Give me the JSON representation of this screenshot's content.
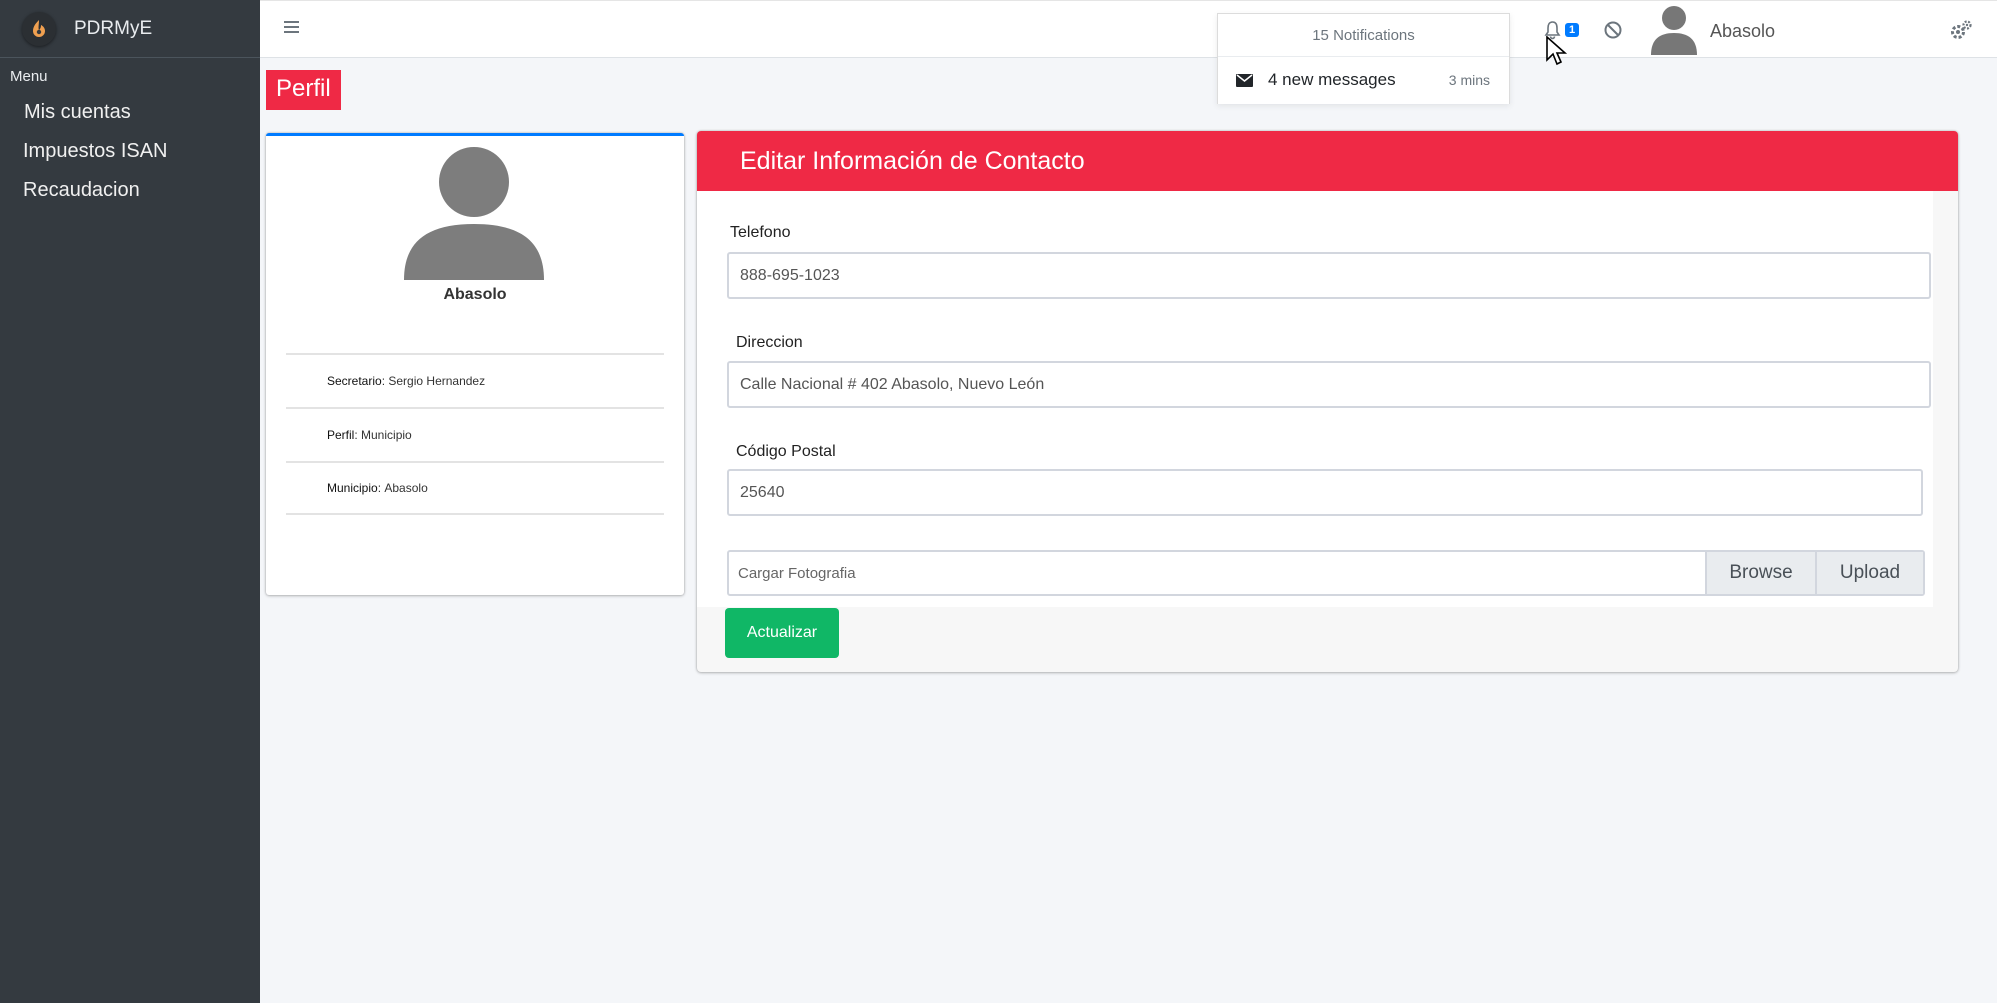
{
  "brand": {
    "name": "PDRMyE"
  },
  "sidebar": {
    "header": "Menu",
    "items": [
      {
        "label": "Mis cuentas"
      },
      {
        "label": "Impuestos ISAN"
      },
      {
        "label": "Recaudacion"
      }
    ]
  },
  "navbar": {
    "notifications": {
      "header": "15 Notifications",
      "items": [
        {
          "text": "4 new messages",
          "time": "3 mins"
        }
      ]
    },
    "badge_count": "1",
    "user_name": "Abasolo"
  },
  "page": {
    "tag": "Perfil"
  },
  "profile": {
    "name": "Abasolo",
    "details": [
      {
        "key": "Secretario",
        "value": "Sergio Hernandez"
      },
      {
        "key": "Perfil",
        "value": "Municipio"
      },
      {
        "key": "Municipio",
        "value": "Abasolo"
      }
    ]
  },
  "form": {
    "title": "Editar Información de Contacto",
    "telefono_label": "Telefono",
    "telefono_value": "888-695-1023",
    "direccion_label": "Direccion",
    "direccion_value": "Calle Nacional # 402 Abasolo, Nuevo León",
    "cp_label": "Código Postal",
    "cp_value": "25640",
    "file_placeholder": "Cargar Fotografia",
    "browse_label": "Browse",
    "upload_label": "Upload",
    "submit_label": "Actualizar"
  },
  "colors": {
    "accent_red": "#ef2945",
    "sidebar_bg": "#343a40",
    "success_green": "#10b766",
    "primary_blue": "#007bff"
  }
}
